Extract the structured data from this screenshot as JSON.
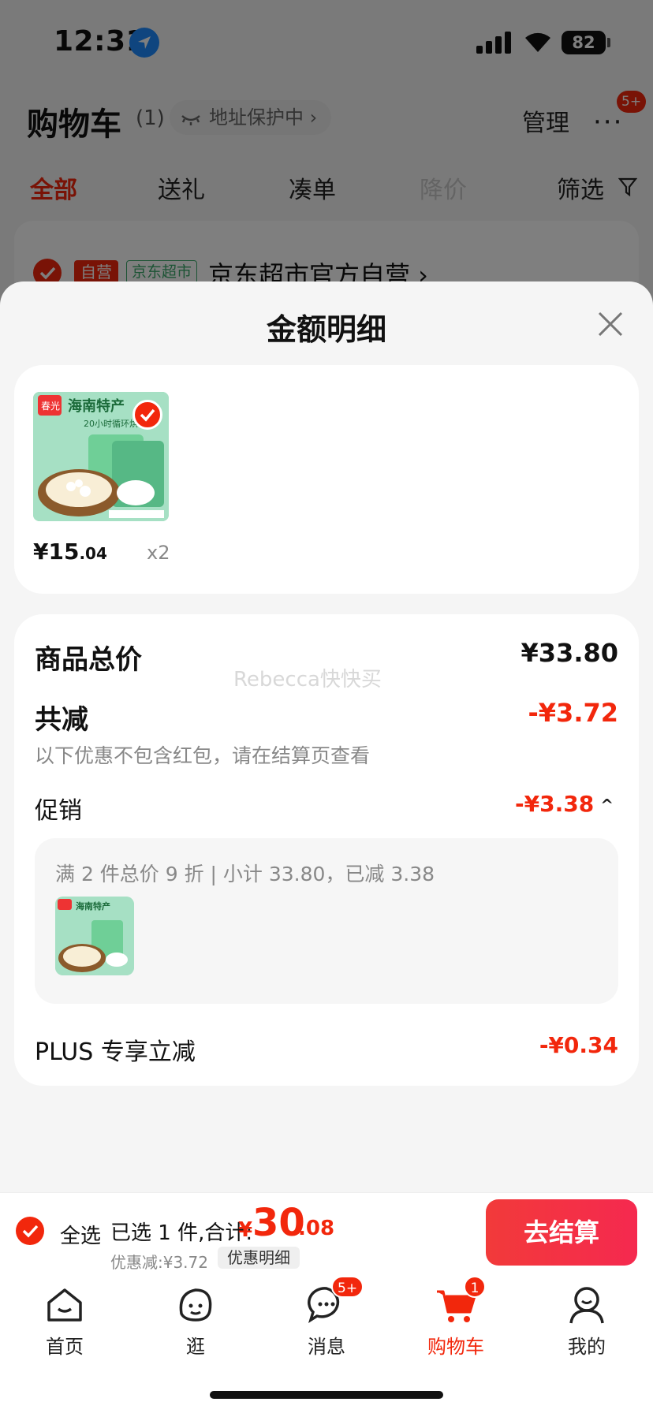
{
  "status_bar": {
    "time": "12:31",
    "battery": "82"
  },
  "header": {
    "title": "购物车",
    "count": "(1)",
    "address_pill": "地址保护中 ›",
    "manage": "管理",
    "more": "···",
    "more_badge": "5+"
  },
  "filter_tabs": [
    {
      "label": "全部",
      "state": "active"
    },
    {
      "label": "送礼",
      "state": "normal"
    },
    {
      "label": "凑单",
      "state": "normal"
    },
    {
      "label": "降价",
      "state": "disabled"
    },
    {
      "label": "筛选",
      "state": "normal"
    }
  ],
  "shop": {
    "tag_self": "自营",
    "tag_super": "京东超市",
    "name": "京东超市官方自营 ›"
  },
  "sheet": {
    "title": "金额明细",
    "goods": {
      "price_int": "¥15",
      "price_dec": ".04",
      "qty": "x2",
      "thumb_text": "海南特产",
      "thumb_sub": "20小时循环烘"
    },
    "watermark": "Rebecca快快买",
    "rows": {
      "goods_total_label": "商品总价",
      "goods_total_value": "¥33.80",
      "reduce_label": "共减",
      "reduce_value": "-¥3.72",
      "reduce_note": "以下优惠不包含红包，请在结算页查看",
      "promo_label": "促销",
      "promo_value": "-¥3.38",
      "promo_detail": "满 2 件总价 9 折 | 小计 33.80，已减 3.38",
      "plus_label": "PLUS 专享立减",
      "plus_value": "-¥0.34"
    }
  },
  "checkout": {
    "select_all": "全选",
    "selected_info": "已选 1 件,合计:",
    "total_yen": "¥",
    "total_int": "30",
    "total_dec": ".08",
    "discount": "优惠减:¥3.72",
    "discount_detail": "优惠明细",
    "button": "去结算"
  },
  "tabs": [
    {
      "label": "首页",
      "icon": "home-icon"
    },
    {
      "label": "逛",
      "icon": "explore-icon"
    },
    {
      "label": "消息",
      "icon": "message-icon",
      "badge": "5+"
    },
    {
      "label": "购物车",
      "icon": "cart-icon",
      "badge": "1",
      "active": true
    },
    {
      "label": "我的",
      "icon": "profile-icon"
    }
  ],
  "colors": {
    "accent": "#f2270c",
    "sheet_bg": "#f5f5f5",
    "mint": "#a6e0c4"
  }
}
